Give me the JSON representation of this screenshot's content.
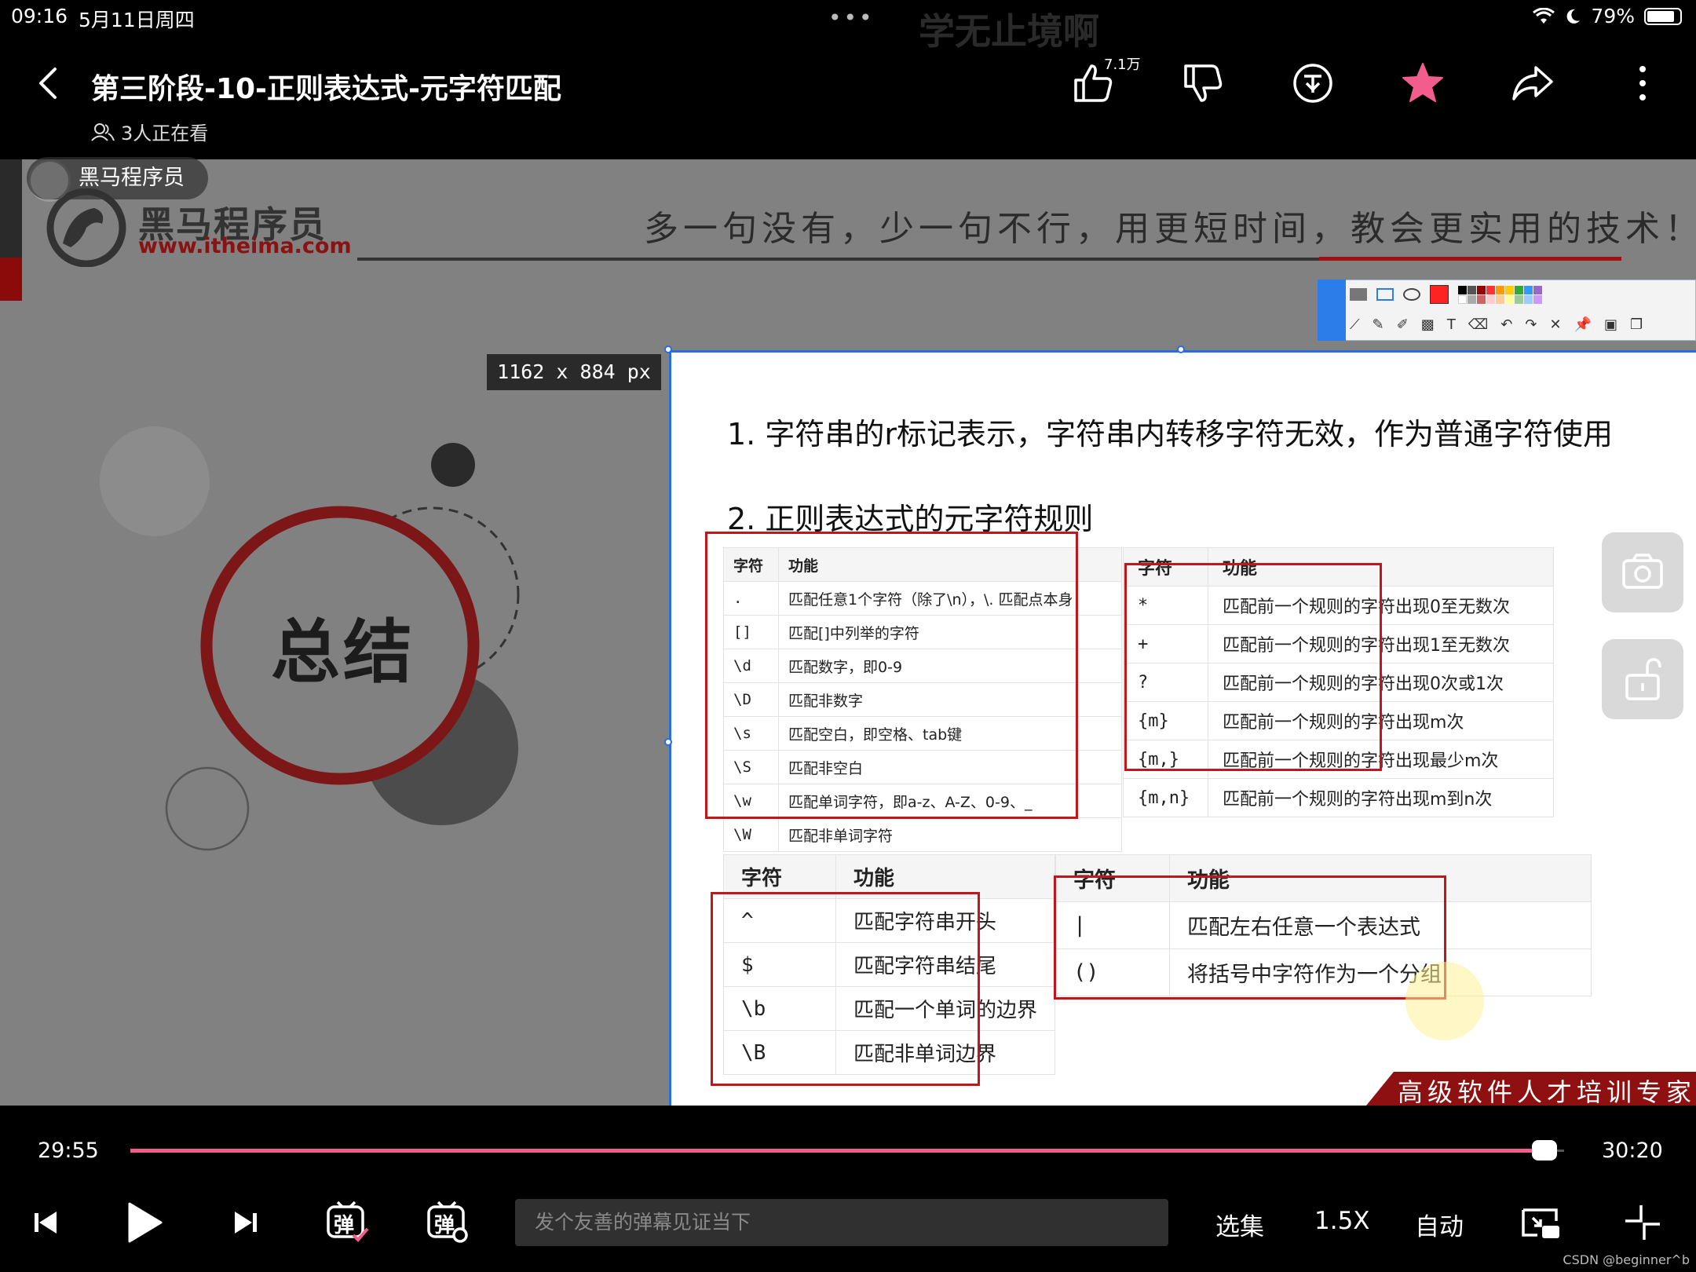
{
  "status_bar": {
    "time": "09:16",
    "date": "5月11日周四",
    "dots": "•••",
    "ghost_text": "学无止境啊",
    "battery": "79%"
  },
  "header": {
    "title": "第三阶段-10-正则表达式-元字符匹配",
    "viewers": "3人正在看",
    "like_count": "7.1万",
    "accent_color": "#f25d8e"
  },
  "video": {
    "channel_name": "黑马程序员",
    "logo_text": "黑马程序员",
    "logo_url": "www.itheima.com",
    "slogan": "多一句没有，少一句不行，用更短时间，教会更实用的技术！",
    "dimension_label": "1162 x 884  px",
    "summary_title": "总结",
    "line1": "1. 字符串的r标记表示，字符串内转移字符无效，作为普通字符使用",
    "line2": "2. 正则表达式的元字符规则",
    "table1": {
      "headers": [
        "字符",
        "功能"
      ],
      "rows": [
        [
          ".",
          "匹配任意1个字符（除了\\n），\\. 匹配点本身"
        ],
        [
          "[]",
          "匹配[]中列举的字符"
        ],
        [
          "\\d",
          "匹配数字，即0-9"
        ],
        [
          "\\D",
          "匹配非数字"
        ],
        [
          "\\s",
          "匹配空白，即空格、tab键"
        ],
        [
          "\\S",
          "匹配非空白"
        ],
        [
          "\\w",
          "匹配单词字符，即a-z、A-Z、0-9、_"
        ],
        [
          "\\W",
          "匹配非单词字符"
        ]
      ]
    },
    "table2": {
      "headers": [
        "字符",
        "功能"
      ],
      "rows": [
        [
          "*",
          "匹配前一个规则的字符出现0至无数次"
        ],
        [
          "+",
          "匹配前一个规则的字符出现1至无数次"
        ],
        [
          "?",
          "匹配前一个规则的字符出现0次或1次"
        ],
        [
          "{m}",
          "匹配前一个规则的字符出现m次"
        ],
        [
          "{m,}",
          "匹配前一个规则的字符出现最少m次"
        ],
        [
          "{m,n}",
          "匹配前一个规则的字符出现m到n次"
        ]
      ]
    },
    "table3": {
      "headers": [
        "字符",
        "功能"
      ],
      "rows": [
        [
          "^",
          "匹配字符串开头"
        ],
        [
          "$",
          "匹配字符串结尾"
        ],
        [
          "\\b",
          "匹配一个单词的边界"
        ],
        [
          "\\B",
          "匹配非单词边界"
        ]
      ]
    },
    "table4": {
      "headers": [
        "字符",
        "功能"
      ],
      "rows": [
        [
          "|",
          "匹配左右任意一个表达式"
        ],
        [
          "()",
          "将括号中字符作为一个分组"
        ]
      ]
    },
    "watermark": "黑马程序员",
    "banner": "高级软件人才培训专家"
  },
  "player": {
    "current_time": "29:55",
    "total_time": "30:20",
    "progress": 0.985,
    "danmaku_placeholder": "发个友善的弹幕见证当下",
    "episodes_label": "选集",
    "speed_label": "1.5X",
    "quality_label": "自动",
    "danmaku_icon_text": "弹"
  },
  "footer": {
    "credit": "CSDN @beginner^b"
  }
}
